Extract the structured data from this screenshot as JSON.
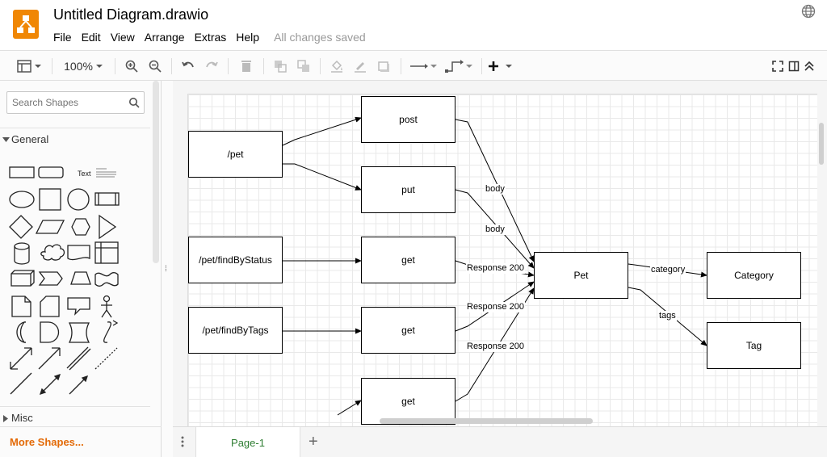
{
  "header": {
    "title": "Untitled Diagram.drawio",
    "menu": [
      "File",
      "Edit",
      "View",
      "Arrange",
      "Extras",
      "Help"
    ],
    "save_status": "All changes saved"
  },
  "toolbar": {
    "zoom": "100%"
  },
  "sidebar": {
    "search_placeholder": "Search Shapes",
    "general_label": "General",
    "text_shape_label": "Text",
    "misc_label": "Misc",
    "more_shapes_label": "More Shapes..."
  },
  "diagram": {
    "nodes": {
      "pet_path": "/pet",
      "post": "post",
      "put": "put",
      "find_by_status": "/pet/findByStatus",
      "get1": "get",
      "find_by_tags": "/pet/findByTags",
      "get2": "get",
      "get3": "get",
      "pet": "Pet",
      "category": "Category",
      "tag": "Tag"
    },
    "edge_labels": {
      "body1": "body",
      "body2": "body",
      "resp1": "Response 200",
      "resp2": "Response 200",
      "resp3": "Response 200",
      "category": "category",
      "tags": "tags"
    }
  },
  "pages": {
    "current": "Page-1"
  },
  "colors": {
    "brand": "#f08705",
    "page_tab_text": "#2e7d32",
    "more_shapes": "#e36a07"
  }
}
